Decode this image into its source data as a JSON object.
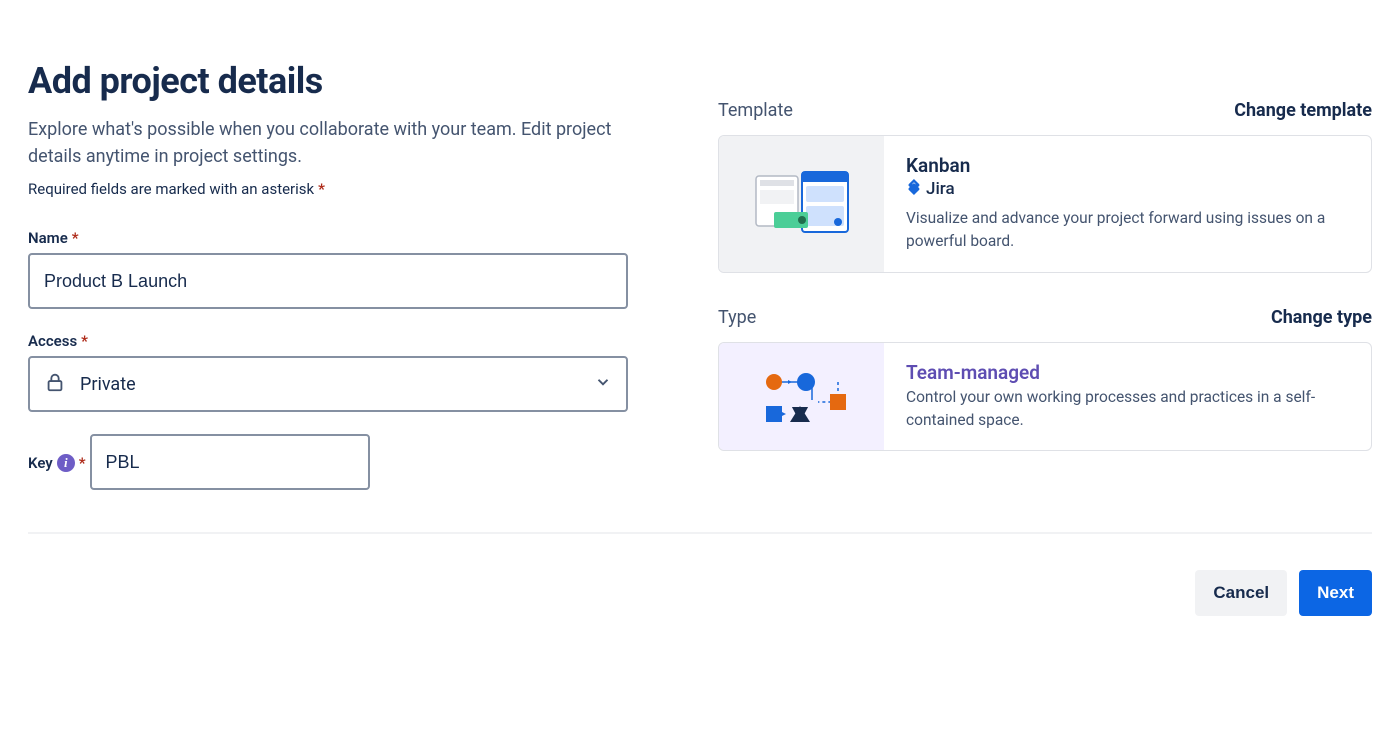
{
  "header": {
    "title": "Add project details",
    "subtitle": "Explore what's possible when you collaborate with your team. Edit project details anytime in project settings.",
    "required_note": "Required fields are marked with an asterisk"
  },
  "form": {
    "name": {
      "label": "Name",
      "value": "Product B Launch"
    },
    "access": {
      "label": "Access",
      "value": "Private"
    },
    "key": {
      "label": "Key",
      "value": "PBL"
    }
  },
  "template": {
    "section_label": "Template",
    "change_label": "Change template",
    "card": {
      "title": "Kanban",
      "brand": "Jira",
      "desc": "Visualize and advance your project forward using issues on a powerful board."
    }
  },
  "type": {
    "section_label": "Type",
    "change_label": "Change type",
    "card": {
      "title": "Team-managed",
      "desc": "Control your own working processes and practices in a self-contained space."
    }
  },
  "footer": {
    "cancel": "Cancel",
    "next": "Next"
  }
}
